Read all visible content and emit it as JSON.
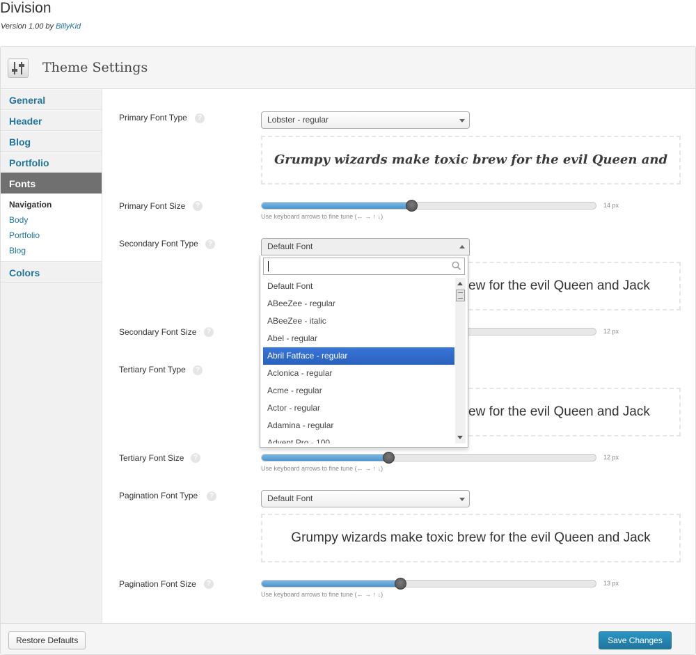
{
  "header": {
    "title": "Division",
    "version_prefix": "Version 1.00 by",
    "author": "BillyKid"
  },
  "panel": {
    "title": "Theme Settings"
  },
  "sidebar": {
    "items": [
      {
        "label": "General"
      },
      {
        "label": "Header"
      },
      {
        "label": "Blog"
      },
      {
        "label": "Portfolio"
      },
      {
        "label": "Fonts"
      },
      {
        "label": "Colors"
      }
    ],
    "active": "Fonts",
    "subitems": [
      {
        "label": "Navigation"
      },
      {
        "label": "Body"
      },
      {
        "label": "Portfolio"
      },
      {
        "label": "Blog"
      }
    ],
    "current_subitem": "Navigation"
  },
  "help_glyph": "?",
  "slider_hint": "Use keyboard arrows to fine tune (← → ↑ ↓)",
  "preview_text": "Grumpy wizards make toxic brew for the evil Queen and Jack",
  "preview_text_clipped": "ew for the evil Queen and Jack",
  "options": {
    "primary_type": {
      "label": "Primary Font Type",
      "value": "Lobster - regular"
    },
    "primary_size": {
      "label": "Primary Font Size",
      "value": "14 px",
      "fraction": 0.45
    },
    "secondary_type": {
      "label": "Secondary Font Type",
      "value": "Default Font"
    },
    "secondary_size": {
      "label": "Secondary Font Size",
      "value": "12 px"
    },
    "tertiary_type": {
      "label": "Tertiary Font Type"
    },
    "tertiary_size": {
      "label": "Tertiary Font Size",
      "value": "12 px",
      "fraction": 0.38
    },
    "pagination_type": {
      "label": "Pagination Font Type",
      "value": "Default Font"
    },
    "pagination_size": {
      "label": "Pagination Font Size",
      "value": "13 px",
      "fraction": 0.415
    }
  },
  "dropdown": {
    "options": [
      "Default Font",
      "ABeeZee - regular",
      "ABeeZee - italic",
      "Abel - regular",
      "Abril Fatface - regular",
      "Aclonica - regular",
      "Acme - regular",
      "Actor - regular",
      "Adamina - regular",
      "Advent Pro - 100"
    ],
    "highlighted": "Abril Fatface - regular",
    "search_value": ""
  },
  "footer": {
    "restore_label": "Restore Defaults",
    "save_label": "Save Changes"
  },
  "colors": {
    "link": "#21759b",
    "active_nav": "#707070",
    "highlight": "#3875d7",
    "slider_fill": "#4a94cf",
    "primary_button": "#21759b"
  }
}
